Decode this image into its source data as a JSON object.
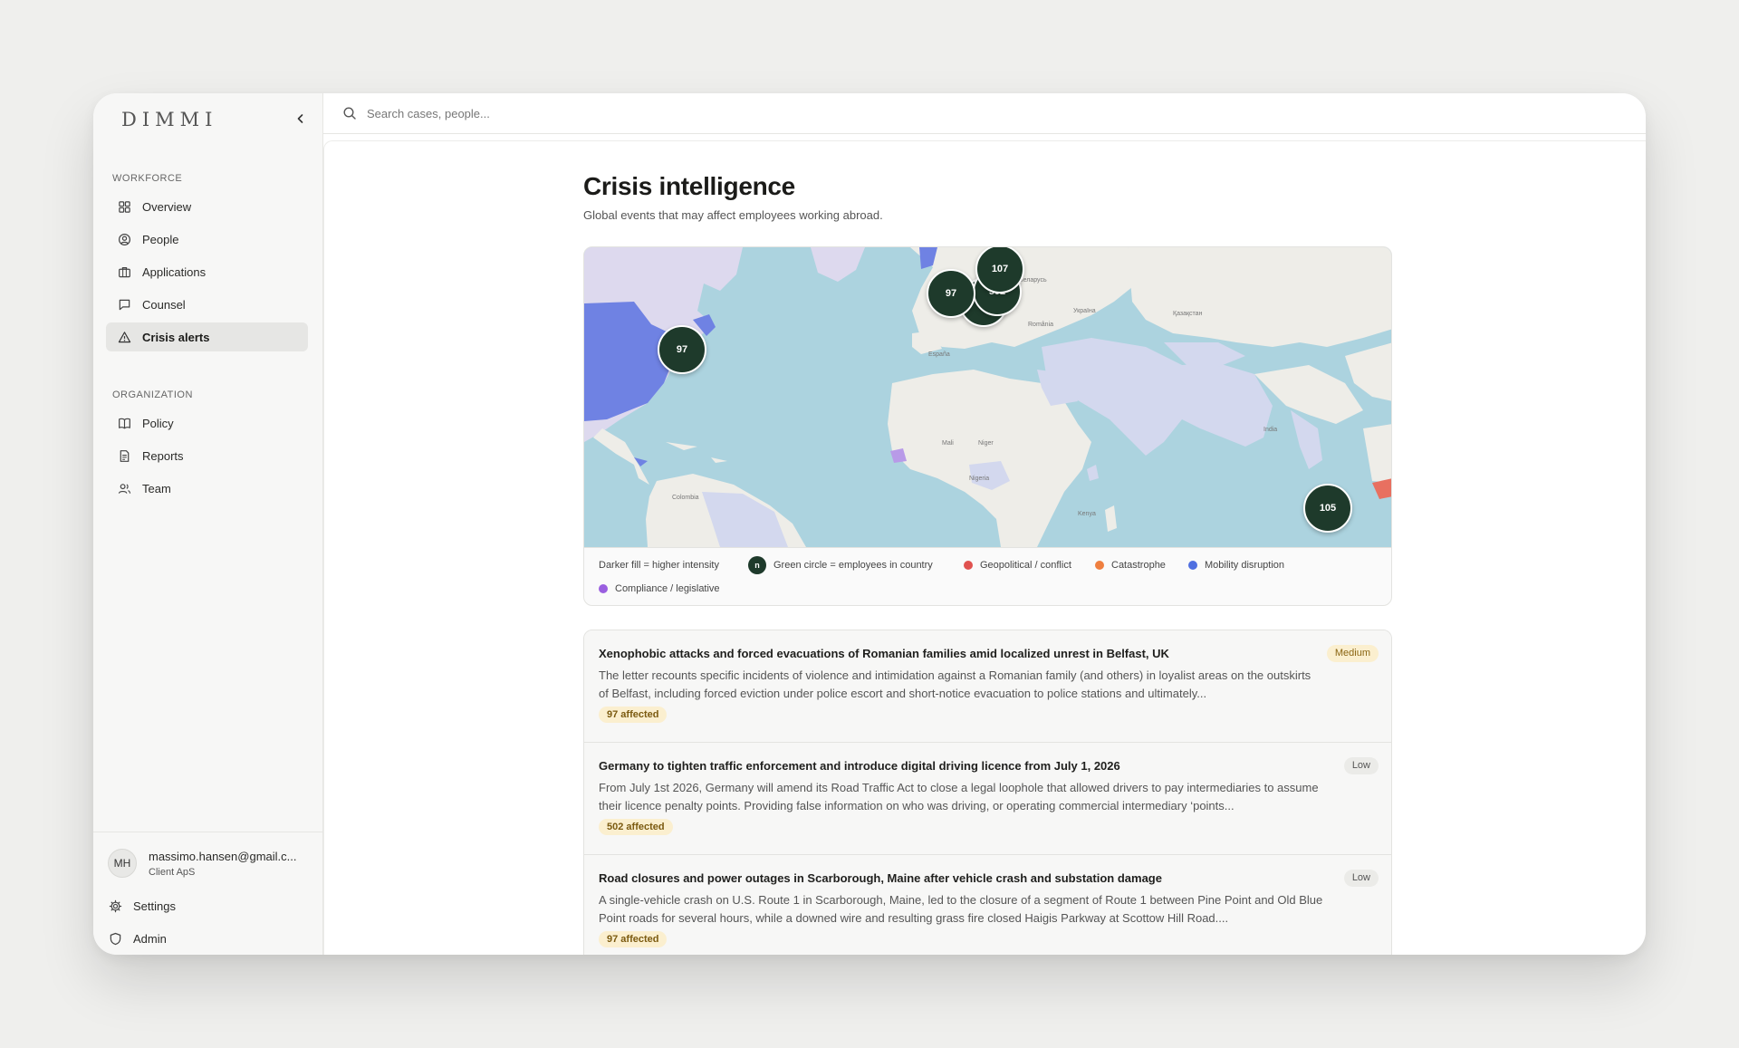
{
  "app": {
    "logo": "DIMMI"
  },
  "sidebar": {
    "workforce_label": "WORKFORCE",
    "workforce_items": [
      {
        "label": "Overview",
        "icon": "grid-icon"
      },
      {
        "label": "People",
        "icon": "user-circle-icon"
      },
      {
        "label": "Applications",
        "icon": "briefcase-icon"
      },
      {
        "label": "Counsel",
        "icon": "message-icon"
      },
      {
        "label": "Crisis alerts",
        "icon": "warning-triangle-icon",
        "active": true
      }
    ],
    "organization_label": "ORGANIZATION",
    "organization_items": [
      {
        "label": "Policy",
        "icon": "book-icon"
      },
      {
        "label": "Reports",
        "icon": "document-icon"
      },
      {
        "label": "Team",
        "icon": "users-icon"
      }
    ],
    "user": {
      "initials": "MH",
      "email": "massimo.hansen@gmail.c...",
      "org": "Client ApS"
    },
    "settings_label": "Settings",
    "admin_label": "Admin"
  },
  "search": {
    "placeholder": "Search cases, people..."
  },
  "main": {
    "title": "Crisis intelligence",
    "subtitle": "Global events that may affect employees working abroad."
  },
  "map": {
    "clusters": [
      {
        "label": "107"
      },
      {
        "label": "502"
      },
      {
        "label": "97"
      },
      {
        "label": "97"
      },
      {
        "label": "105"
      }
    ],
    "legend": {
      "intensity": "Darker fill = higher intensity",
      "circle_glyph": "n",
      "circle": "Green circle = employees in country",
      "categories": [
        {
          "label": "Geopolitical / conflict",
          "color": "#e0524f"
        },
        {
          "label": "Catastrophe",
          "color": "#ef7f3f"
        },
        {
          "label": "Mobility disruption",
          "color": "#4f6fe0"
        },
        {
          "label": "Compliance / legislative",
          "color": "#9a5fe0"
        }
      ]
    }
  },
  "alerts": [
    {
      "title": "Xenophobic attacks and forced evacuations of Romanian families amid localized unrest in Belfast, UK",
      "description": "The letter recounts specific incidents of violence and intimidation against a Romanian family (and others) in loyalist areas on the outskirts of Belfast, including forced eviction under police escort and short-notice evacuation to police stations and ultimately...",
      "affected": "97 affected",
      "severity": "Medium"
    },
    {
      "title": "Germany to tighten traffic enforcement and introduce digital driving licence from July 1, 2026",
      "description": "From July 1st 2026, Germany will amend its Road Traffic Act to close a legal loophole that allowed drivers to pay intermediaries to assume their licence penalty points. Providing false information on who was driving, or operating commercial intermediary ‘points...",
      "affected": "502 affected",
      "severity": "Low"
    },
    {
      "title": "Road closures and power outages in Scarborough, Maine after vehicle crash and substation damage",
      "description": "A single-vehicle crash on U.S. Route 1 in Scarborough, Maine, led to the closure of a segment of Route 1 between Pine Point and Old Blue Point roads for several hours, while a downed wire and resulting grass fire closed Haigis Parkway at Scottow Hill Road....",
      "affected": "97 affected",
      "severity": "Low"
    }
  ]
}
